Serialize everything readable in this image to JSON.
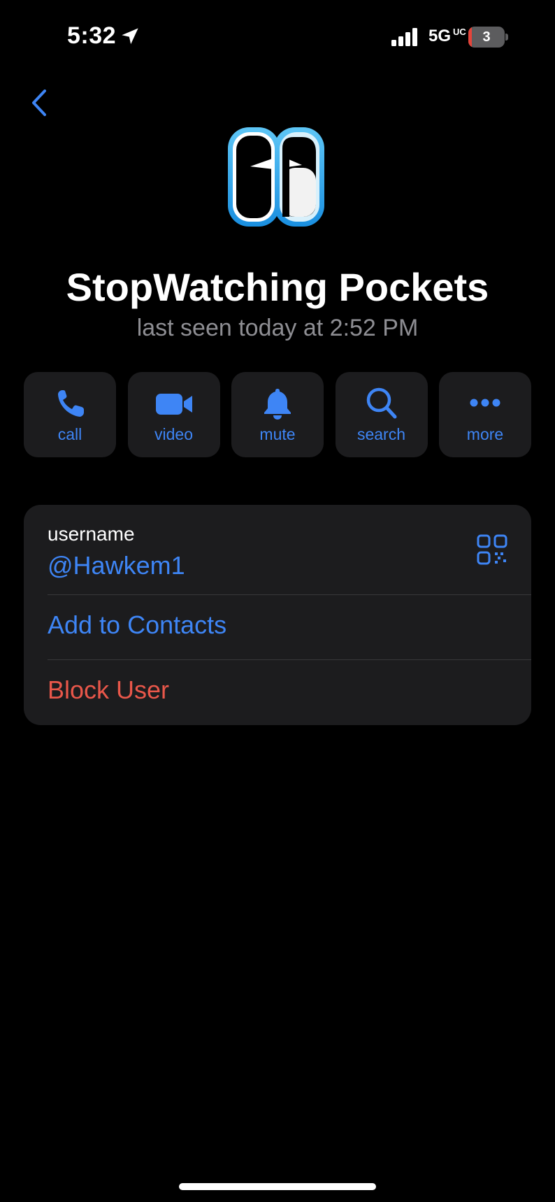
{
  "status_bar": {
    "time": "5:32",
    "network": "5G",
    "network_sub": "UC",
    "battery": "3"
  },
  "profile": {
    "name": "StopWatching Pockets",
    "last_seen": "last seen today at 2:52 PM"
  },
  "actions": [
    {
      "label": "call",
      "icon": "phone-icon"
    },
    {
      "label": "video",
      "icon": "video-camera-icon"
    },
    {
      "label": "mute",
      "icon": "bell-icon"
    },
    {
      "label": "search",
      "icon": "search-icon"
    },
    {
      "label": "more",
      "icon": "more-dots-icon"
    }
  ],
  "info": {
    "username_label": "username",
    "username": "@Hawkem1",
    "add_contact": "Add to Contacts",
    "block": "Block User"
  },
  "colors": {
    "accent": "#3e85f5",
    "danger": "#e9574a",
    "card": "#1c1c1e",
    "background": "#000000"
  }
}
